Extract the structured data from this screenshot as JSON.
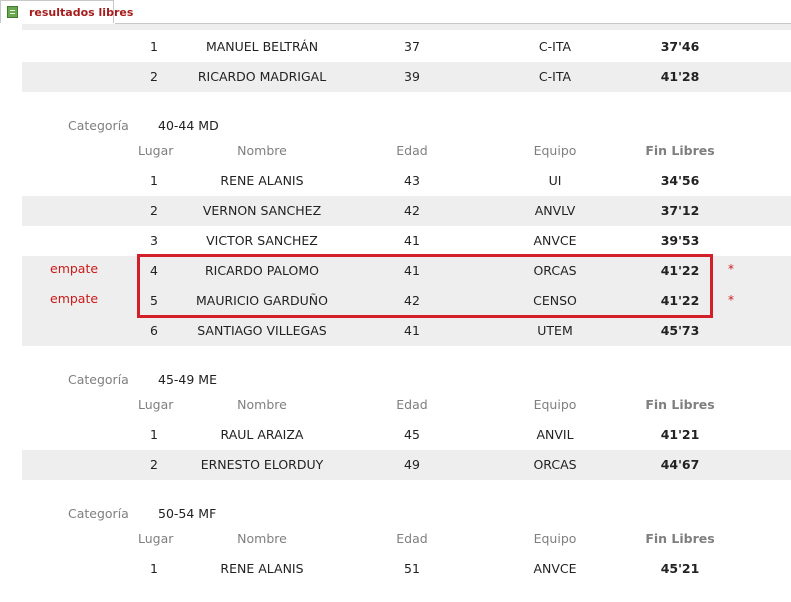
{
  "tab": {
    "label": "resultados libres",
    "icon": "report-icon"
  },
  "colors": {
    "accent": "#d31f2a",
    "tab_text": "#a61c1c",
    "alt_row": "#eeeeee",
    "header_text": "#7f7f7f"
  },
  "headers": {
    "lugar": "Lugar",
    "nombre": "Nombre",
    "edad": "Edad",
    "equipo": "Equipo",
    "fin": "Fin Libres"
  },
  "category_label": "Categoría",
  "top_rows": [
    {
      "lugar": "1",
      "nombre": "MANUEL BELTRÁN",
      "edad": "37",
      "equipo": "C-ITA",
      "fin": "37'46"
    },
    {
      "lugar": "2",
      "nombre": "RICARDO MADRIGAL",
      "edad": "39",
      "equipo": "C-ITA",
      "fin": "41'28"
    }
  ],
  "categories": [
    {
      "name": "40-44 MD",
      "rows": [
        {
          "lugar": "1",
          "nombre": "RENE ALANIS",
          "edad": "43",
          "equipo": "UI",
          "fin": "34'56"
        },
        {
          "lugar": "2",
          "nombre": "VERNON SANCHEZ",
          "edad": "42",
          "equipo": "ANVLV",
          "fin": "37'12"
        },
        {
          "lugar": "3",
          "nombre": "VICTOR SANCHEZ",
          "edad": "41",
          "equipo": "ANVCE",
          "fin": "39'53"
        },
        {
          "lugar": "4",
          "nombre": "RICARDO PALOMO",
          "edad": "41",
          "equipo": "ORCAS",
          "fin": "41'22"
        },
        {
          "lugar": "5",
          "nombre": "MAURICIO GARDUÑO",
          "edad": "42",
          "equipo": "CENSO",
          "fin": "41'22"
        },
        {
          "lugar": "6",
          "nombre": "SANTIAGO VILLEGAS",
          "edad": "41",
          "equipo": "UTEM",
          "fin": "45'73"
        }
      ]
    },
    {
      "name": "45-49 ME",
      "rows": [
        {
          "lugar": "1",
          "nombre": "RAUL ARAIZA",
          "edad": "45",
          "equipo": "ANVIL",
          "fin": "41'21"
        },
        {
          "lugar": "2",
          "nombre": "ERNESTO ELORDUY",
          "edad": "49",
          "equipo": "ORCAS",
          "fin": "44'67"
        }
      ]
    },
    {
      "name": "50-54 MF",
      "rows": [
        {
          "lugar": "1",
          "nombre": "RENE ALANIS",
          "edad": "51",
          "equipo": "ANVCE",
          "fin": "45'21"
        }
      ]
    }
  ],
  "annotations": {
    "tie_label": "empate",
    "tie_star": "*"
  }
}
